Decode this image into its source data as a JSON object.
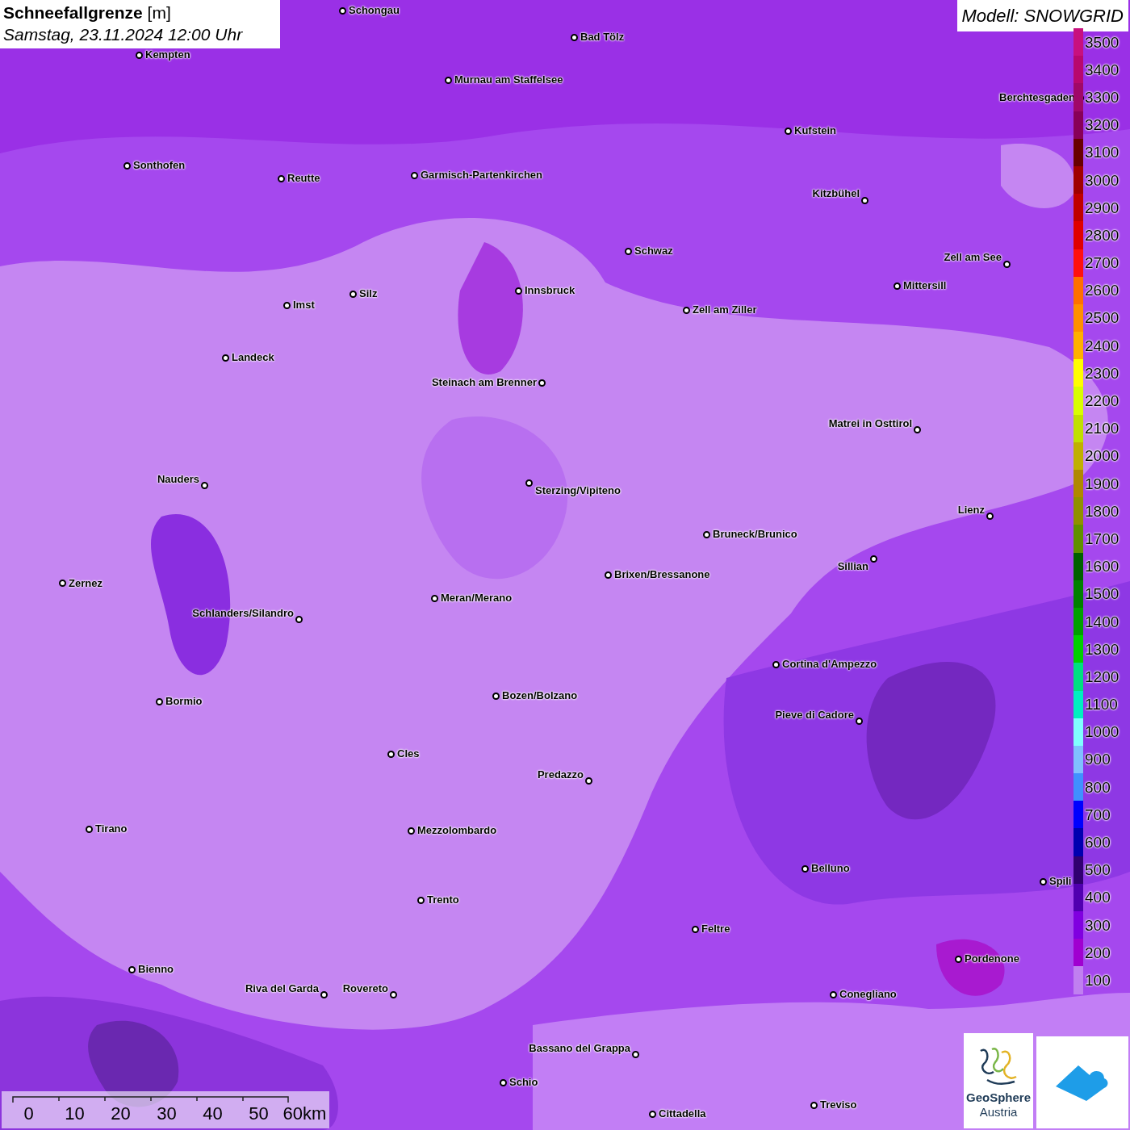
{
  "header": {
    "title": "**Schneefallgrenze** [m]",
    "subtitle": "Samstag, 23.11.2024 12:00 Uhr"
  },
  "model": "Modell: SNOWGRID",
  "cities": [
    "Schongau",
    "Bad Tölz",
    "Kempten",
    "Murnau am Staffelsee",
    "Kufstein",
    "Sonthofen",
    "Reutte",
    "Garmisch-Partenkirchen",
    "Berchtesgaden",
    "Kitzbühel",
    "Schwaz",
    "Zell am See",
    "Mittersill",
    "Innsbruck",
    "Imst",
    "Silz",
    "Zell am Ziller",
    "Landeck",
    "Steinach am Brenner",
    "Matrei in Osttirol",
    "Nauders",
    "Sterzing/Vipiteno",
    "Lienz",
    "Bruneck/Brunico",
    "Sillian",
    "Zernez",
    "Brixen/Bressanone",
    "Meran/Merano",
    "Schlanders/Silandro",
    "Cortina d'Ampezzo",
    "Bormio",
    "Bozen/Bolzano",
    "Pieve di Cadore",
    "Cles",
    "Predazzo",
    "Tirano",
    "Mezzolombardo",
    "Belluno",
    "Spili",
    "Trento",
    "Feltre",
    "Pordenone",
    "Bienno",
    "Riva del Garda",
    "Rovereto",
    "Conegliano",
    "Bassano del Grappa",
    "Schio",
    "Cittadella",
    "Treviso"
  ],
  "legend": [
    {
      "label": "3500",
      "color": "#c8107e"
    },
    {
      "label": "3400",
      "color": "#b8086e"
    },
    {
      "label": "3300",
      "color": "#a00868"
    },
    {
      "label": "3200",
      "color": "#880058"
    },
    {
      "label": "3100",
      "color": "#680000"
    },
    {
      "label": "3000",
      "color": "#a00000"
    },
    {
      "label": "2900",
      "color": "#c00000"
    },
    {
      "label": "2800",
      "color": "#e00000"
    },
    {
      "label": "2700",
      "color": "#ff1010"
    },
    {
      "label": "2600",
      "color": "#ff7000"
    },
    {
      "label": "2500",
      "color": "#ff9000"
    },
    {
      "label": "2400",
      "color": "#ffb000"
    },
    {
      "label": "2300",
      "color": "#ffff00"
    },
    {
      "label": "2200",
      "color": "#d8ff00"
    },
    {
      "label": "2100",
      "color": "#c0e000"
    },
    {
      "label": "2000",
      "color": "#c0b000"
    },
    {
      "label": "1900",
      "color": "#b08800"
    },
    {
      "label": "1800",
      "color": "#909000"
    },
    {
      "label": "1700",
      "color": "#609000"
    },
    {
      "label": "1600",
      "color": "#006000"
    },
    {
      "label": "1500",
      "color": "#008000"
    },
    {
      "label": "1400",
      "color": "#00a000"
    },
    {
      "label": "1300",
      "color": "#00d000"
    },
    {
      "label": "1200",
      "color": "#00e080"
    },
    {
      "label": "1100",
      "color": "#00f0c0"
    },
    {
      "label": "1000",
      "color": "#80ffff"
    },
    {
      "label": "900",
      "color": "#80c0ff"
    },
    {
      "label": "800",
      "color": "#4090ff"
    },
    {
      "label": "700",
      "color": "#0000ff"
    },
    {
      "label": "600",
      "color": "#0000b0"
    },
    {
      "label": "500",
      "color": "#300070"
    },
    {
      "label": "400",
      "color": "#5000b0"
    },
    {
      "label": "300",
      "color": "#8000e0"
    },
    {
      "label": "200",
      "color": "#a000d0"
    },
    {
      "label": "100",
      "color": "#c080f0"
    }
  ],
  "scale": [
    "0",
    "10",
    "20",
    "30",
    "40",
    "50",
    "60km"
  ],
  "logo": {
    "name": "GeoSphere",
    "country": "Austria"
  }
}
